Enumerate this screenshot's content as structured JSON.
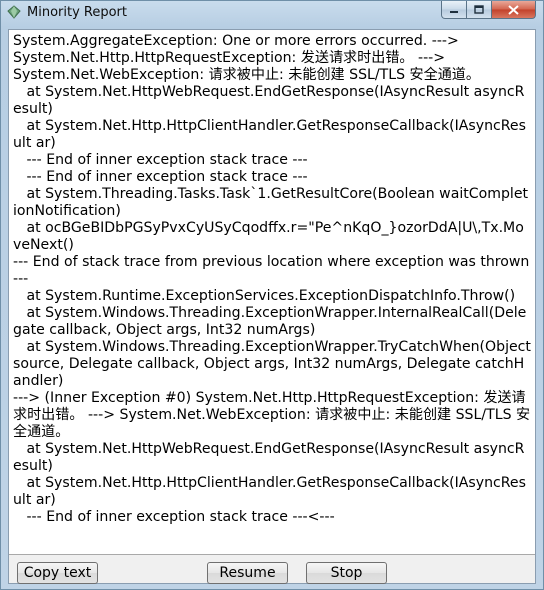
{
  "window": {
    "title": "Minority Report",
    "icon": "diamond-app-icon",
    "controls": {
      "minimize": "minimize-icon",
      "maximize": "maximize-icon",
      "close": "close-icon"
    }
  },
  "report": {
    "text": "System.AggregateException: One or more errors occurred. ---> \nSystem.Net.Http.HttpRequestException: 发送请求时出错。 ---> \nSystem.Net.WebException: 请求被中止: 未能创建 SSL/TLS 安全通道。\n   at System.Net.HttpWebRequest.EndGetResponse(IAsyncResult asyncResult)\n   at System.Net.Http.HttpClientHandler.GetResponseCallback(IAsyncResult ar)\n   --- End of inner exception stack trace ---\n   --- End of inner exception stack trace ---\n   at System.Threading.Tasks.Task`1.GetResultCore(Boolean waitCompletionNotification)\n   at ocBGeBIDbPGSyPvxCyUSyCqodffx.r=\"Pe^nKqO_}ozorDdA|U\\,Tx.MoveNext()\n--- End of stack trace from previous location where exception was thrown ---\n   at System.Runtime.ExceptionServices.ExceptionDispatchInfo.Throw()\n   at System.Windows.Threading.ExceptionWrapper.InternalRealCall(Delegate callback, Object args, Int32 numArgs)\n   at System.Windows.Threading.ExceptionWrapper.TryCatchWhen(Object source, Delegate callback, Object args, Int32 numArgs, Delegate catchHandler)\n---> (Inner Exception #0) System.Net.Http.HttpRequestException: 发送请求时出错。 ---> System.Net.WebException: 请求被中止: 未能创建 SSL/TLS 安全通道。\n   at System.Net.HttpWebRequest.EndGetResponse(IAsyncResult asyncResult)\n   at System.Net.Http.HttpClientHandler.GetResponseCallback(IAsyncResult ar)\n   --- End of inner exception stack trace ---<---"
  },
  "buttons": {
    "copy": "Copy text",
    "resume": "Resume",
    "stop": "Stop"
  }
}
